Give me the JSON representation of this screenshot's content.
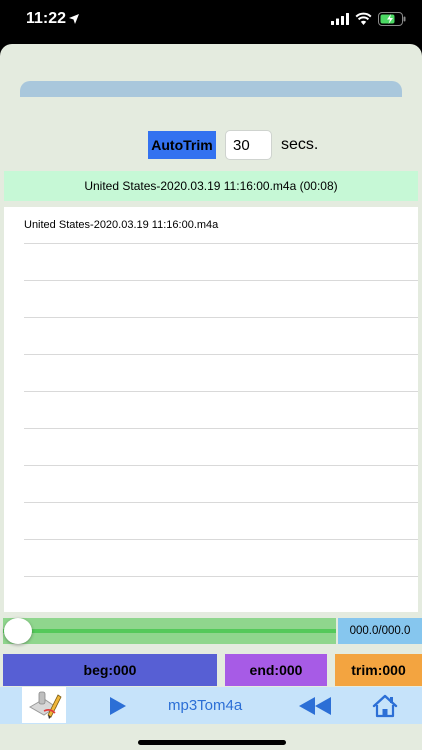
{
  "status_bar": {
    "time": "11:22"
  },
  "autotrim": {
    "button_label": "AutoTrim",
    "seconds_value": "30",
    "seconds_unit": "secs."
  },
  "selected_file": "United States-2020.03.19 11:16:00.m4a (00:08)",
  "files": [
    "United States-2020.03.19 11:16:00.m4a"
  ],
  "player": {
    "progress": 0,
    "time_readout": "000.0/000.0"
  },
  "markers": {
    "beg_label": "beg:000",
    "end_label": "end:000",
    "trim_label": "trim:000"
  },
  "toolbar": {
    "app_name": "mp3Tom4a",
    "icons": [
      "app-logo",
      "play-icon",
      "rewind-icon",
      "home-icon"
    ]
  },
  "colors": {
    "autotrim": "#3372f0",
    "selected_file_bg": "#c6f8d6",
    "progress": "#8fd68d",
    "time_readout": "#86c6ee",
    "beg": "#575fd4",
    "end": "#a75be6",
    "trim": "#f3a440",
    "toolbar": "#c6e3fa",
    "toolbar_text": "#2c6fd6"
  }
}
